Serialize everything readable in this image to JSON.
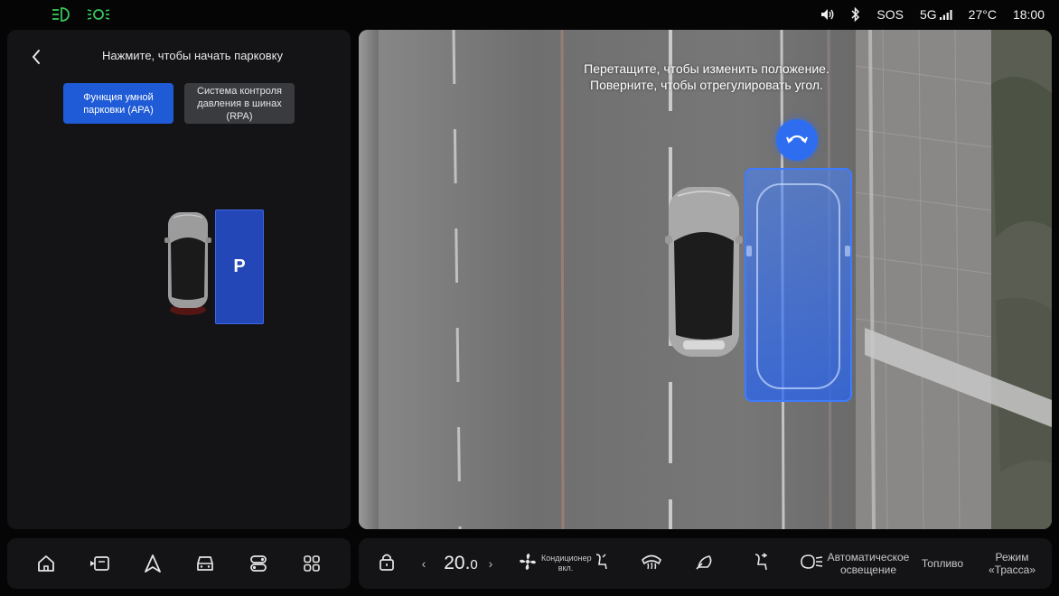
{
  "statusbar": {
    "left_icons": [
      "headlight-icon",
      "parking-light-icon"
    ],
    "sos": "SOS",
    "network": "5G",
    "temperature": "27°C",
    "time": "18:00",
    "icons": [
      "volume-icon",
      "bluetooth-icon",
      "signal-icon"
    ]
  },
  "parking_panel": {
    "title": "Нажмите, чтобы начать парковку",
    "modes": [
      {
        "label": "Функция умной парковки (APA)",
        "selected": true
      },
      {
        "label": "Система контроля давления в шинах (RPA)",
        "selected": false
      }
    ],
    "slot_label": "P"
  },
  "camera_view": {
    "hint_line1": "Перетащите, чтобы изменить положение.",
    "hint_line2": "Поверните, чтобы отрегулировать угол."
  },
  "dock": {
    "left_icons": [
      "home-icon",
      "media-icon",
      "navigation-icon",
      "car-icon",
      "control-icon",
      "apps-icon"
    ],
    "temp_main": "20.",
    "temp_decimal": "0",
    "ac_label": "Кондиционер вкл.",
    "auto_light_label": "Автоматическое освещение",
    "fuel_label": "Топливо",
    "mode_label": "Режим «Трасса»"
  },
  "colors": {
    "accent_blue": "#1f5bd6",
    "slot_blue": "#2447b8",
    "indicator_green": "#37c95a",
    "panel_bg": "#141416"
  }
}
